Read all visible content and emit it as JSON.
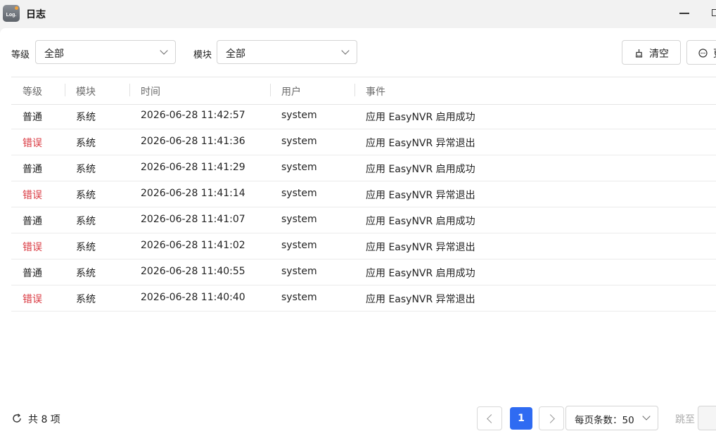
{
  "window": {
    "title": "日志",
    "icon_text": "Log."
  },
  "filters": {
    "level_label": "等级",
    "level_value": "全部",
    "module_label": "模块",
    "module_value": "全部"
  },
  "toolbar": {
    "clear_label": "清空",
    "more_label": "更"
  },
  "table": {
    "columns": [
      "等级",
      "模块",
      "时间",
      "用户",
      "事件"
    ],
    "rows": [
      {
        "level": "普通",
        "module": "系统",
        "time": "2026-06-28 11:42:57",
        "user": "system",
        "event": "应用 EasyNVR 启用成功",
        "level_type": "normal"
      },
      {
        "level": "错误",
        "module": "系统",
        "time": "2026-06-28 11:41:36",
        "user": "system",
        "event": "应用 EasyNVR 异常退出",
        "level_type": "error"
      },
      {
        "level": "普通",
        "module": "系统",
        "time": "2026-06-28 11:41:29",
        "user": "system",
        "event": "应用 EasyNVR 启用成功",
        "level_type": "normal"
      },
      {
        "level": "错误",
        "module": "系统",
        "time": "2026-06-28 11:41:14",
        "user": "system",
        "event": "应用 EasyNVR 异常退出",
        "level_type": "error"
      },
      {
        "level": "普通",
        "module": "系统",
        "time": "2026-06-28 11:41:07",
        "user": "system",
        "event": "应用 EasyNVR 启用成功",
        "level_type": "normal"
      },
      {
        "level": "错误",
        "module": "系统",
        "time": "2026-06-28 11:41:02",
        "user": "system",
        "event": "应用 EasyNVR 异常退出",
        "level_type": "error"
      },
      {
        "level": "普通",
        "module": "系统",
        "time": "2026-06-28 11:40:55",
        "user": "system",
        "event": "应用 EasyNVR 启用成功",
        "level_type": "normal"
      },
      {
        "level": "错误",
        "module": "系统",
        "time": "2026-06-28 11:40:40",
        "user": "system",
        "event": "应用 EasyNVR 异常退出",
        "level_type": "error"
      }
    ]
  },
  "footer": {
    "total_text": "共 8 项",
    "current_page": "1",
    "page_size_label": "每页条数：50",
    "jump_label": "跳至"
  },
  "colors": {
    "accent": "#2f6bf2",
    "error": "#d9363e"
  },
  "icons": {
    "clear": "broom-icon",
    "more": "ellipsis-circle-icon",
    "refresh": "refresh-icon",
    "dropdown": "chevron-down-icon"
  }
}
